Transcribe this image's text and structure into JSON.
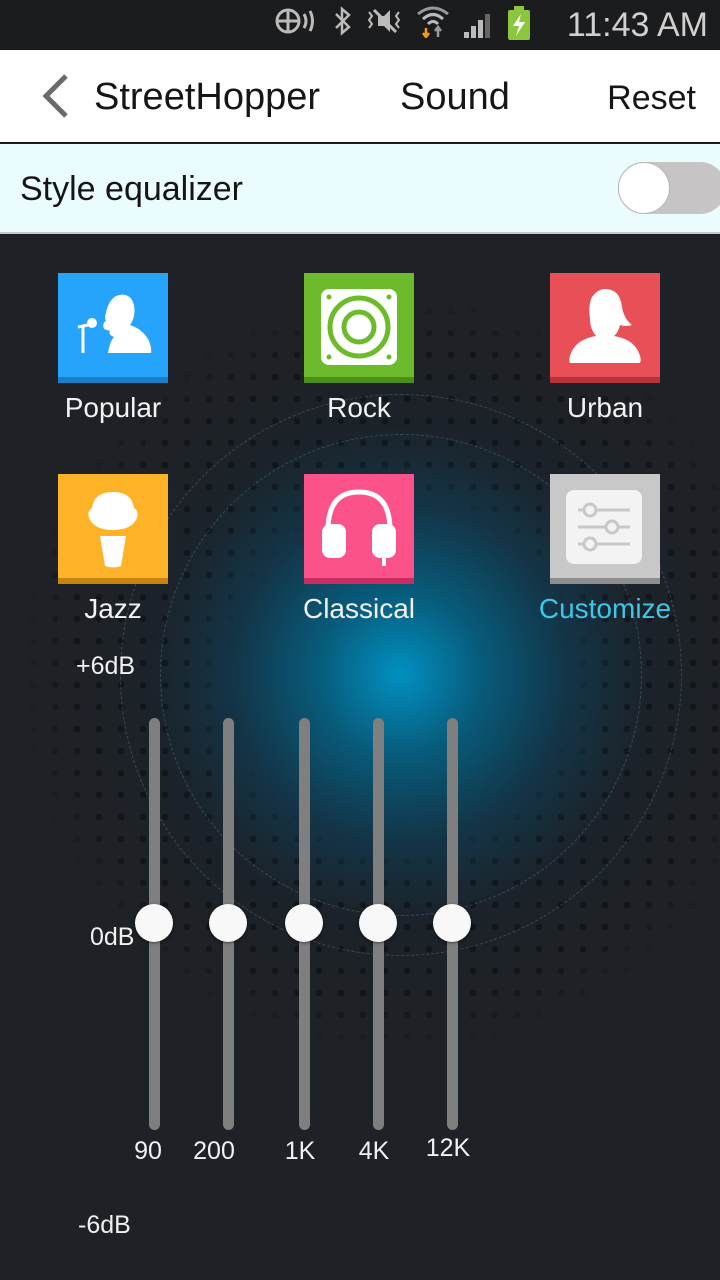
{
  "status_bar": {
    "time": "11:43 AM",
    "icons": [
      "nfc-icon",
      "bluetooth-icon",
      "mute-icon",
      "wifi-icon",
      "signal-icon",
      "battery-charging-icon"
    ]
  },
  "header": {
    "app_title": "StreetHopper",
    "page_title": "Sound",
    "reset_label": "Reset"
  },
  "style_equalizer": {
    "label": "Style equalizer",
    "enabled": false
  },
  "presets": [
    {
      "label": "Popular",
      "icon": "singer-icon",
      "color": "#26a4fb",
      "shade": "#1a7fc7",
      "active": false
    },
    {
      "label": "Rock",
      "icon": "speaker-icon",
      "color": "#6bbb2c",
      "shade": "#4d8d1c",
      "active": false
    },
    {
      "label": "Urban",
      "icon": "woman-icon",
      "color": "#e94f57",
      "shade": "#b5333a",
      "active": false
    },
    {
      "label": "Jazz",
      "icon": "microphone-icon",
      "color": "#fdb227",
      "shade": "#c78510",
      "active": false
    },
    {
      "label": "Classical",
      "icon": "headphones-icon",
      "color": "#fb5289",
      "shade": "#c72d60",
      "active": false
    },
    {
      "label": "Customize",
      "icon": "sliders-icon",
      "color": "#c8c8c8",
      "shade": "#8e8e8e",
      "active": true
    }
  ],
  "equalizer": {
    "max_label": "+6dB",
    "mid_label": "0dB",
    "min_label": "-6dB",
    "range_db": [
      -6,
      6
    ],
    "bands": [
      {
        "freq": "90",
        "gain_db": 0
      },
      {
        "freq": "200",
        "gain_db": 0
      },
      {
        "freq": "1K",
        "gain_db": 0
      },
      {
        "freq": "4K",
        "gain_db": 0
      },
      {
        "freq": "12K",
        "gain_db": 0
      }
    ]
  },
  "colors": {
    "accent": "#3fc6e6",
    "toggle_row_bg": "#eafcfd",
    "track": "#7f7f80"
  }
}
